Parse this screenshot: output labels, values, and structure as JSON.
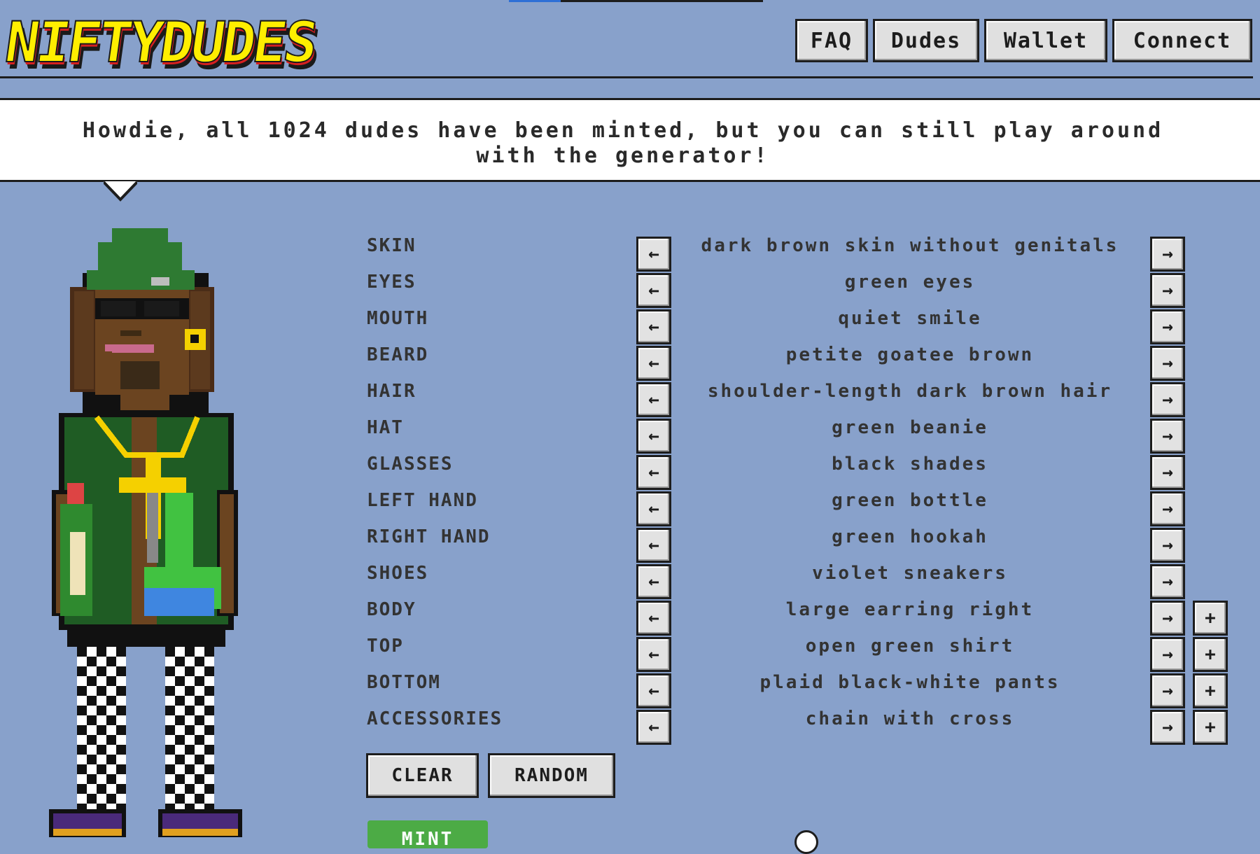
{
  "header": {
    "logo_text": "NIFTYDUDES",
    "nav": [
      "FAQ",
      "Dudes",
      "Wallet",
      "Connect"
    ]
  },
  "bubble": {
    "line1": "Howdie, all 1024 dudes have been minted, but you can still play around",
    "line2": "with the generator!"
  },
  "traits": [
    {
      "label": "SKIN",
      "value": "dark brown skin without genitals"
    },
    {
      "label": "EYES",
      "value": "green eyes"
    },
    {
      "label": "MOUTH",
      "value": "quiet smile"
    },
    {
      "label": "BEARD",
      "value": "petite goatee brown"
    },
    {
      "label": "HAIR",
      "value": "shoulder-length dark brown hair"
    },
    {
      "label": "HAT",
      "value": "green beanie"
    },
    {
      "label": "GLASSES",
      "value": "black shades"
    },
    {
      "label": "LEFT HAND",
      "value": "green bottle"
    },
    {
      "label": "RIGHT HAND",
      "value": "green hookah"
    },
    {
      "label": "SHOES",
      "value": "violet sneakers"
    },
    {
      "label": "BODY",
      "value": "large earring right"
    },
    {
      "label": "TOP",
      "value": "open green shirt"
    },
    {
      "label": "BOTTOM",
      "value": "plaid black-white pants"
    },
    {
      "label": "ACCESSORIES",
      "value": "chain with cross"
    }
  ],
  "controls": {
    "prev_symbol": "←",
    "next_symbol": "→",
    "add_symbol": "+",
    "clear_label": "CLEAR",
    "random_label": "RANDOM",
    "mint_label": "MINT"
  },
  "colors": {
    "background": "#88a1cb",
    "logo_yellow": "#ffee00",
    "logo_red": "#d62020",
    "mint_green": "#4cab45"
  }
}
